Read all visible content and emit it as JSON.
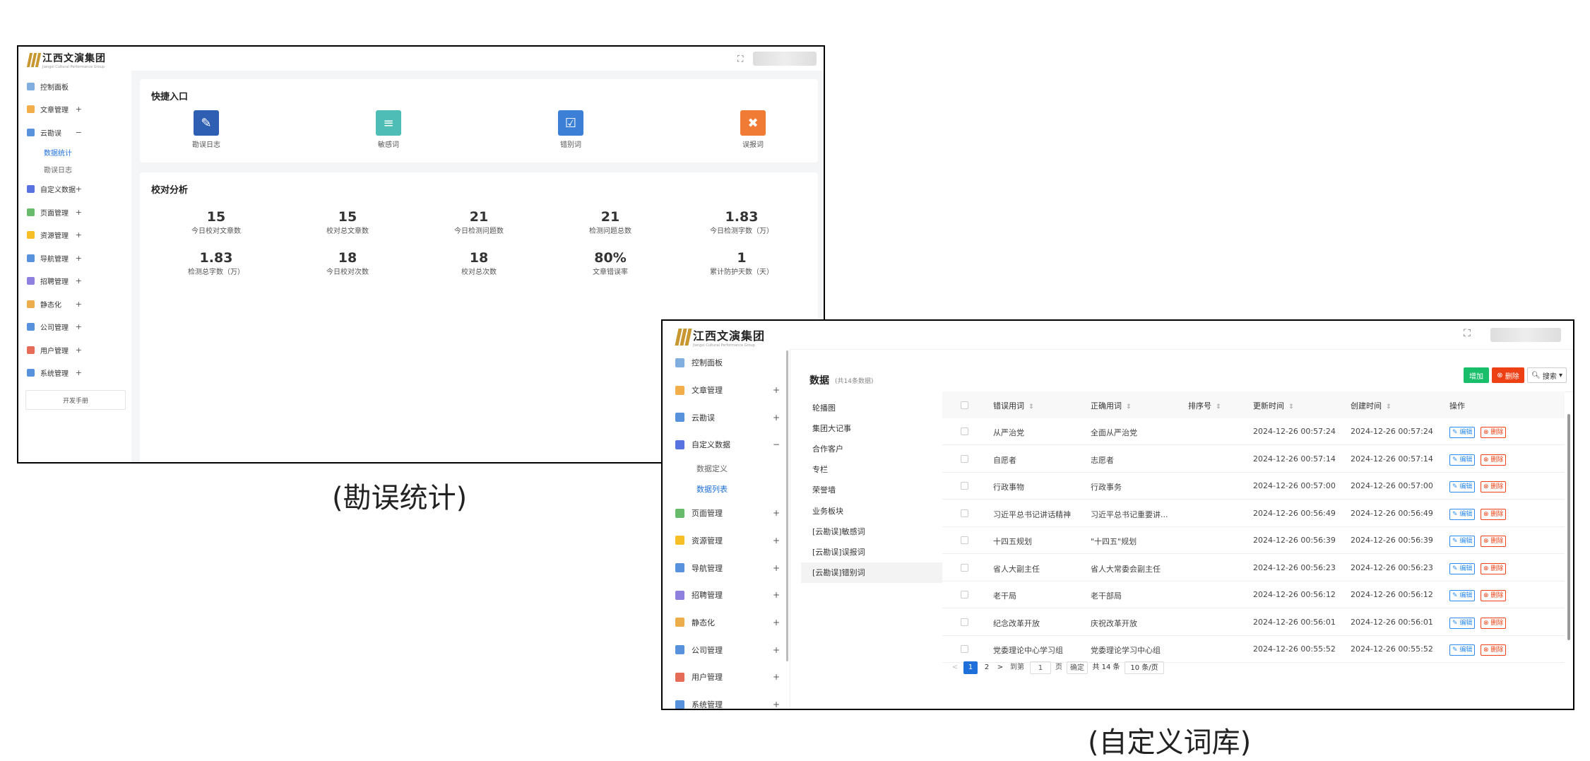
{
  "w1": {
    "logo": {
      "name": "江西文演集团",
      "sub": "Jiangxi Cultural Performance Group"
    },
    "sidebar": [
      {
        "label": "控制面板",
        "icon": "chart-icon",
        "color": "#6aa0d8",
        "toggle": ""
      },
      {
        "label": "文章管理",
        "icon": "article-icon",
        "color": "#f0a02a",
        "toggle": "+"
      },
      {
        "label": "云勘误",
        "icon": "cloud-check-icon",
        "color": "#3b7fd6",
        "toggle": "−"
      },
      {
        "label": "数据统计",
        "icon": "",
        "color": "",
        "toggle": "",
        "sub": true,
        "active": true
      },
      {
        "label": "勘误日志",
        "icon": "",
        "color": "",
        "toggle": "",
        "sub": true
      },
      {
        "label": "自定义数据",
        "icon": "blocks-icon",
        "color": "#3b5bdb",
        "toggle": "+"
      },
      {
        "label": "页面管理",
        "icon": "page-icon",
        "color": "#4caf50",
        "toggle": "+"
      },
      {
        "label": "资源管理",
        "icon": "folder-icon",
        "color": "#f5b400",
        "toggle": "+"
      },
      {
        "label": "导航管理",
        "icon": "list-icon",
        "color": "#3b7fd6",
        "toggle": "+"
      },
      {
        "label": "招聘管理",
        "icon": "recruit-icon",
        "color": "#7a6ad8",
        "toggle": "+"
      },
      {
        "label": "静态化",
        "icon": "box-icon",
        "color": "#e8a02a",
        "toggle": "+"
      },
      {
        "label": "公司管理",
        "icon": "building-icon",
        "color": "#3b7fd6",
        "toggle": "+"
      },
      {
        "label": "用户管理",
        "icon": "user-icon",
        "color": "#e0533a",
        "toggle": "+"
      },
      {
        "label": "系统管理",
        "icon": "settings-icon",
        "color": "#3b7fd6",
        "toggle": "+"
      }
    ],
    "dev_manual": "开发手册",
    "quick": {
      "title": "快捷入口",
      "items": [
        {
          "label": "勘误日志",
          "color": "#2f5fb3",
          "glyph": "✎",
          "icon": "log-icon"
        },
        {
          "label": "敏感词",
          "color": "#4dbdb5",
          "glyph": "≡",
          "icon": "sensitive-icon"
        },
        {
          "label": "错别词",
          "color": "#3b7fd6",
          "glyph": "☑",
          "icon": "typo-icon"
        },
        {
          "label": "误报词",
          "color": "#f07b35",
          "glyph": "✖",
          "icon": "false-alarm-icon"
        }
      ]
    },
    "analysis": {
      "title": "校对分析",
      "stats": [
        {
          "num": "15",
          "label": "今日校对文章数"
        },
        {
          "num": "15",
          "label": "校对总文章数"
        },
        {
          "num": "21",
          "label": "今日检测问题数"
        },
        {
          "num": "21",
          "label": "检测问题总数"
        },
        {
          "num": "1.83",
          "label": "今日检测字数（万）"
        },
        {
          "num": "1.83",
          "label": "检测总字数（万）"
        },
        {
          "num": "18",
          "label": "今日校对次数"
        },
        {
          "num": "18",
          "label": "校对总次数"
        },
        {
          "num": "80%",
          "label": "文章错误率"
        },
        {
          "num": "1",
          "label": "累计防护天数（天）"
        }
      ]
    }
  },
  "caption1": "(勘误统计)",
  "w2": {
    "logo": {
      "name": "江西文演集团",
      "sub": "Jiangxi Cultural Performance Group"
    },
    "sidebar": [
      {
        "label": "控制面板",
        "icon": "chart-icon",
        "color": "#6aa0d8",
        "toggle": ""
      },
      {
        "label": "文章管理",
        "icon": "article-icon",
        "color": "#f0a02a",
        "toggle": "+"
      },
      {
        "label": "云勘误",
        "icon": "cloud-check-icon",
        "color": "#3b7fd6",
        "toggle": "+"
      },
      {
        "label": "自定义数据",
        "icon": "blocks-icon",
        "color": "#3b5bdb",
        "toggle": "−"
      },
      {
        "label": "数据定义",
        "icon": "",
        "color": "",
        "toggle": "",
        "sub": true
      },
      {
        "label": "数据列表",
        "icon": "",
        "color": "",
        "toggle": "",
        "sub": true,
        "active": true
      },
      {
        "label": "页面管理",
        "icon": "page-icon",
        "color": "#4caf50",
        "toggle": "+"
      },
      {
        "label": "资源管理",
        "icon": "folder-icon",
        "color": "#f5b400",
        "toggle": "+"
      },
      {
        "label": "导航管理",
        "icon": "list-icon",
        "color": "#3b7fd6",
        "toggle": "+"
      },
      {
        "label": "招聘管理",
        "icon": "recruit-icon",
        "color": "#7a6ad8",
        "toggle": "+"
      },
      {
        "label": "静态化",
        "icon": "box-icon",
        "color": "#e8a02a",
        "toggle": "+"
      },
      {
        "label": "公司管理",
        "icon": "building-icon",
        "color": "#3b7fd6",
        "toggle": "+"
      },
      {
        "label": "用户管理",
        "icon": "user-icon",
        "color": "#e0533a",
        "toggle": "+"
      },
      {
        "label": "系统管理",
        "icon": "settings-icon",
        "color": "#3b7fd6",
        "toggle": "+"
      }
    ],
    "panel": {
      "title": "数据",
      "count": "(共14条数据)",
      "items": [
        "轮播图",
        "集团大记事",
        "合作客户",
        "专栏",
        "荣誉墙",
        "业务板块",
        "[云勘误]敏感词",
        "[云勘误]误报词",
        "[云勘误]错别词"
      ],
      "active_index": 8
    },
    "toolbar": {
      "add": "增加",
      "delete": "删除",
      "search": "搜索"
    },
    "columns": [
      "错误用词",
      "正确用词",
      "排序号",
      "更新时间",
      "创建时间",
      "操作"
    ],
    "rows": [
      [
        "从严治党",
        "全面从严治党",
        "",
        "2024-12-26 00:57:24",
        "2024-12-26 00:57:24"
      ],
      [
        "自愿者",
        "志愿者",
        "",
        "2024-12-26 00:57:14",
        "2024-12-26 00:57:14"
      ],
      [
        "行政事物",
        "行政事务",
        "",
        "2024-12-26 00:57:00",
        "2024-12-26 00:57:00"
      ],
      [
        "习近平总书记讲话精神",
        "习近平总书记重要讲...",
        "",
        "2024-12-26 00:56:49",
        "2024-12-26 00:56:49"
      ],
      [
        "十四五规划",
        "\"十四五\"规划",
        "",
        "2024-12-26 00:56:39",
        "2024-12-26 00:56:39"
      ],
      [
        "省人大副主任",
        "省人大常委会副主任",
        "",
        "2024-12-26 00:56:23",
        "2024-12-26 00:56:23"
      ],
      [
        "老干局",
        "老干部局",
        "",
        "2024-12-26 00:56:12",
        "2024-12-26 00:56:12"
      ],
      [
        "纪念改革开放",
        "庆祝改革开放",
        "",
        "2024-12-26 00:56:01",
        "2024-12-26 00:56:01"
      ],
      [
        "党委理论中心学习组",
        "党委理论学习中心组",
        "",
        "2024-12-26 00:55:52",
        "2024-12-26 00:55:52"
      ]
    ],
    "row_actions": {
      "edit": "编辑",
      "delete": "删除"
    },
    "pagination": {
      "prev": "<",
      "pages": [
        "1",
        "2"
      ],
      "next": ">",
      "goto": "到第",
      "page_value": "1",
      "page_unit": "页",
      "confirm": "确定",
      "total": "共 14 条",
      "page_size": "10 条/页"
    }
  },
  "caption2": "(自定义词库)",
  "colors": {
    "accent": "#1e6fd9",
    "add": "#19be6b",
    "delete": "#ed4014",
    "edit": "#2d8cf0"
  }
}
